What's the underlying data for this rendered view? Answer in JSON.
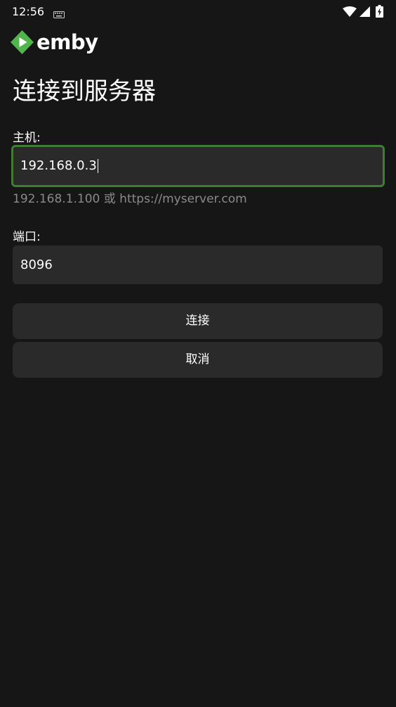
{
  "status_bar": {
    "time": "12:56",
    "icons": [
      "keyboard-icon",
      "wifi-icon",
      "signal-icon",
      "battery-charging-icon"
    ]
  },
  "logo": {
    "text": "emby",
    "brand_color": "#52b54b"
  },
  "page": {
    "title": "连接到服务器"
  },
  "host": {
    "label": "主机:",
    "value": "192.168.0.3",
    "hint": "192.168.1.100 或 https://myserver.com",
    "focus_color": "#3e7d33"
  },
  "port": {
    "label": "端口:",
    "value": "8096"
  },
  "buttons": {
    "connect": "连接",
    "cancel": "取消"
  },
  "colors": {
    "background": "#161616",
    "surface": "#2a2a2a",
    "hint": "#8a8a8a"
  }
}
